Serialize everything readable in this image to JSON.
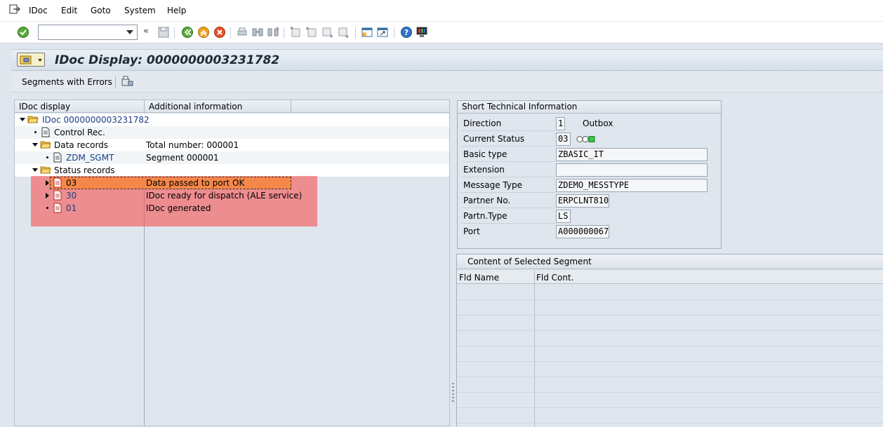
{
  "menu": {
    "items": [
      "IDoc",
      "Edit",
      "Goto",
      "System",
      "Help"
    ]
  },
  "toolbar": {
    "command_value": "",
    "nav_back_glyph": "«"
  },
  "title": {
    "text": "IDoc Display: 0000000003231782"
  },
  "app_toolbar": {
    "segments_with_errors": "Segments with Errors"
  },
  "tree": {
    "columns": [
      "IDoc display",
      "Additional information"
    ],
    "root": "IDoc 0000000003231782",
    "control": "Control Rec.",
    "data_records": {
      "label": "Data records",
      "info": "Total number: 000001"
    },
    "segment": {
      "label": "ZDM_SGMT",
      "info": "Segment 000001"
    },
    "status_records": "Status records",
    "statuses": [
      {
        "code": "03",
        "info": "Data passed to port OK"
      },
      {
        "code": "30",
        "info": "IDoc ready for dispatch (ALE service)"
      },
      {
        "code": "01",
        "info": "IDoc generated"
      }
    ]
  },
  "tech_info": {
    "title": "Short Technical Information",
    "direction": {
      "label": "Direction",
      "value": "1",
      "text": "Outbox"
    },
    "current_status": {
      "label": "Current Status",
      "value": "03"
    },
    "basic_type": {
      "label": "Basic type",
      "value": "ZBASIC_IT"
    },
    "extension": {
      "label": "Extension",
      "value": ""
    },
    "message_type": {
      "label": "Message Type",
      "value": "ZDEMO_MESSTYPE"
    },
    "partner_no": {
      "label": "Partner No.",
      "value": "ERPCLNT810"
    },
    "partn_type": {
      "label": "Partn.Type",
      "value": "LS"
    },
    "port": {
      "label": "Port",
      "value": "A000000067"
    }
  },
  "segment_content": {
    "title": "Content of Selected Segment",
    "columns": [
      "Fld Name",
      "Fld Cont."
    ]
  },
  "colors": {
    "error_overlay": "#f55555",
    "selected_row": "#f6874a",
    "status_light_green": "#2ecc40"
  }
}
